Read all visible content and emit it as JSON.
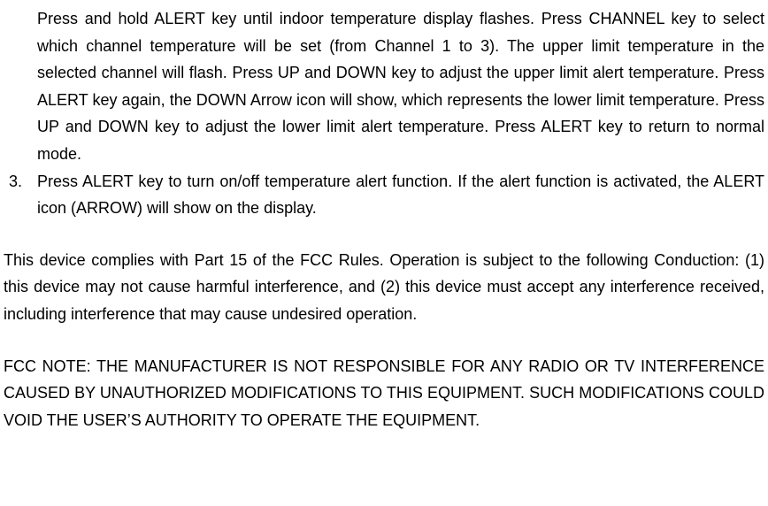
{
  "step2_continued": "Press and hold ALERT key until indoor temperature display flashes. Press CHANNEL key to select which channel temperature will be set (from Channel 1 to 3). The upper limit temperature in the selected channel will flash. Press UP and DOWN key to adjust the upper limit alert temperature. Press ALERT key again, the DOWN Arrow icon will show, which represents the lower limit temperature. Press UP and DOWN key to adjust the lower limit alert temperature. Press ALERT key to return to normal mode.",
  "step3_marker": "3.",
  "step3_text": "Press ALERT key to turn on/off temperature alert function. If the alert function is activated, the ALERT icon (ARROW) will show on the display.",
  "fcc_compliance": "This device complies with Part 15 of the FCC Rules. Operation is subject to the following Conduction: (1) this device may not cause harmful interference, and (2) this device must accept any interference received, including interference that may cause undesired operation.",
  "fcc_note": "FCC NOTE: THE MANUFACTURER IS NOT RESPONSIBLE FOR ANY RADIO OR TV INTERFERENCE CAUSED BY UNAUTHORIZED MODIFICATIONS TO THIS EQUIPMENT. SUCH MODIFICATIONS COULD VOID THE USER’S AUTHORITY TO OPERATE THE EQUIPMENT."
}
